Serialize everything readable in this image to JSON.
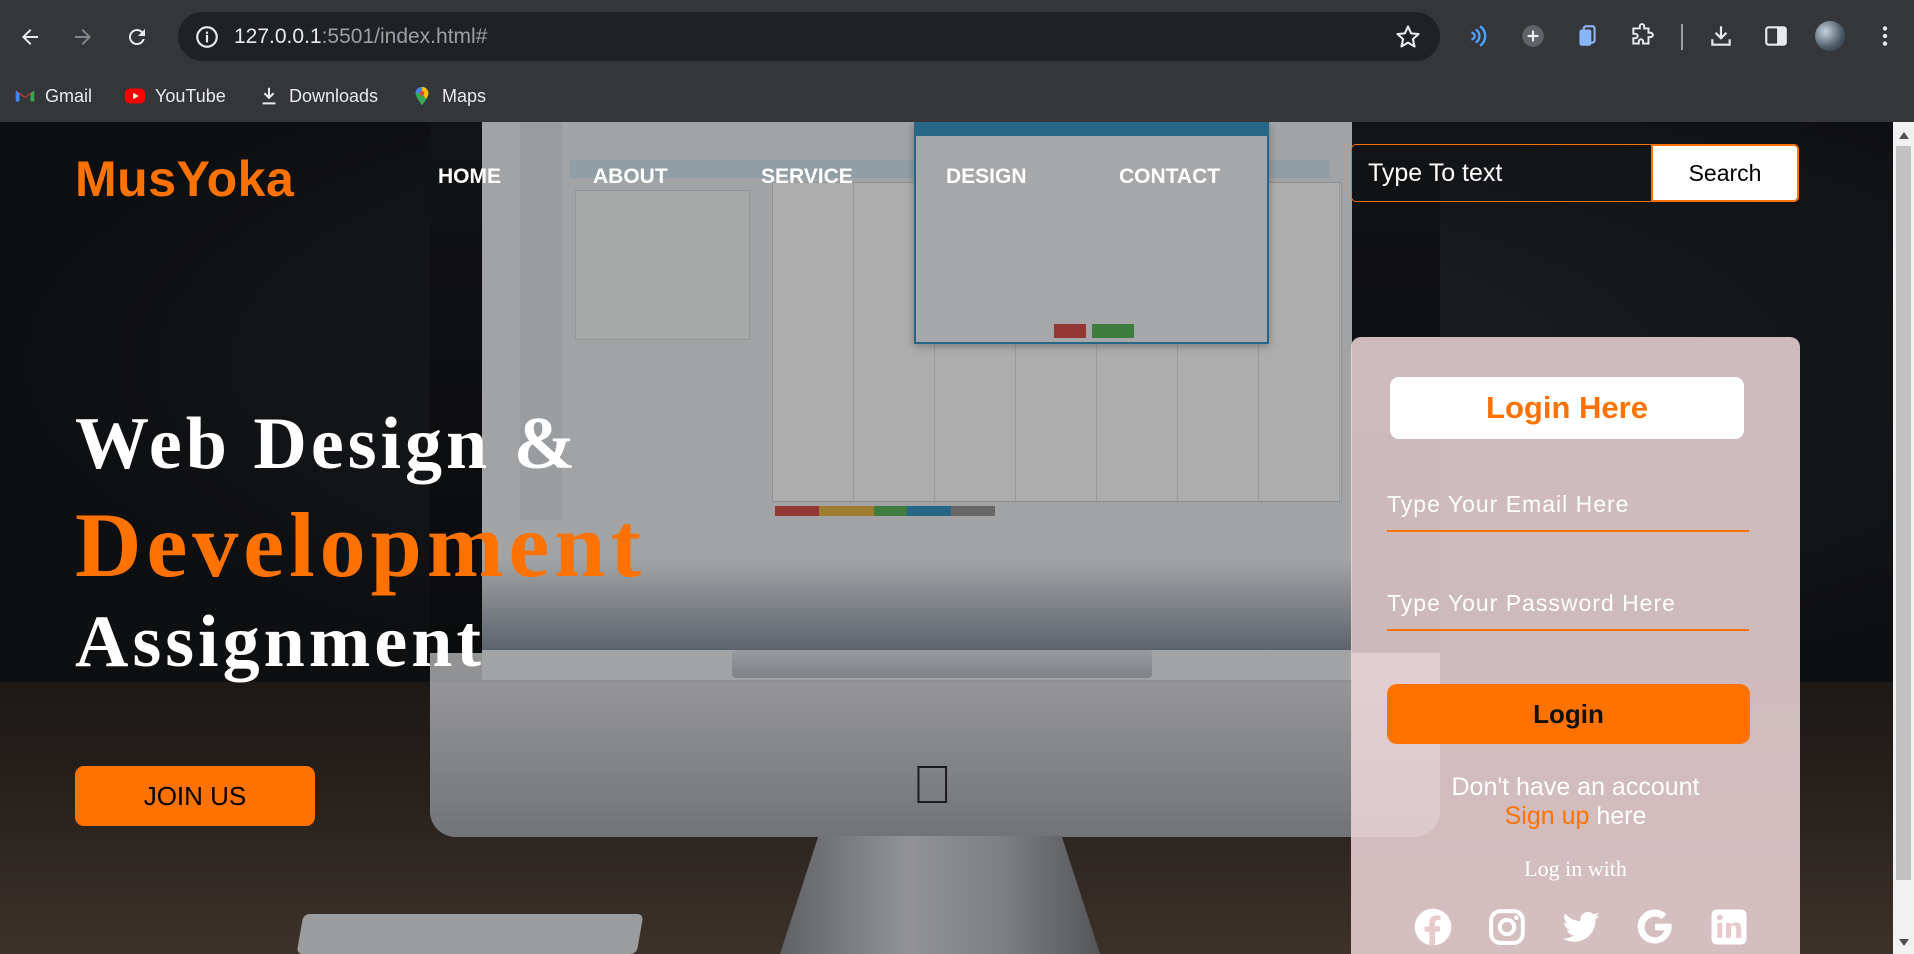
{
  "browser": {
    "url_host": "127.0.0.1",
    "url_rest": ":5501/index.html#",
    "bookmarks": [
      {
        "label": "Gmail",
        "icon": "gmail-icon"
      },
      {
        "label": "YouTube",
        "icon": "youtube-icon"
      },
      {
        "label": "Downloads",
        "icon": "download-icon"
      },
      {
        "label": "Maps",
        "icon": "maps-icon"
      }
    ]
  },
  "site": {
    "logo": "MusYoka",
    "nav": [
      "HOME",
      "ABOUT",
      "SERVICE",
      "DESIGN",
      "CONTACT"
    ],
    "search": {
      "placeholder": "Type To text",
      "button": "Search"
    },
    "hero": {
      "line1": "Web Design &",
      "line2": "Development",
      "line3": "Assignment",
      "cta": "JOIN US"
    },
    "login": {
      "title": "Login Here",
      "email_placeholder": "Type Your Email Here",
      "password_placeholder": "Type Your Password Here",
      "button": "Login",
      "no_account": "Don't have an account",
      "signup_link": "Sign up",
      "signup_suffix": " here",
      "login_with": "Log in with",
      "socials": [
        "facebook-icon",
        "instagram-icon",
        "twitter-icon",
        "google-icon",
        "linkedin-icon"
      ]
    },
    "colors": {
      "accent": "#ff7200",
      "text": "#ffffff"
    }
  }
}
